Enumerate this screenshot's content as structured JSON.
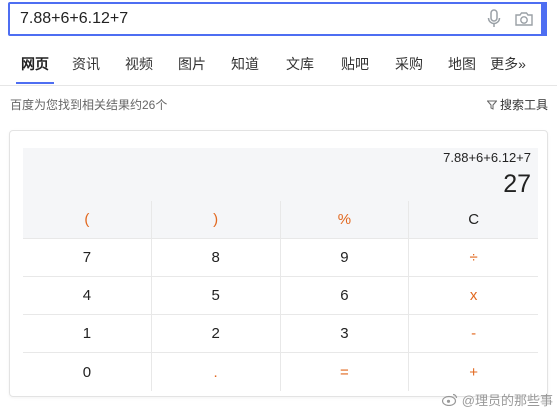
{
  "search": {
    "query": "7.88+6+6.12+7"
  },
  "tabs": [
    "网页",
    "资讯",
    "视频",
    "图片",
    "知道",
    "文库",
    "贴吧",
    "采购",
    "地图",
    "更多»"
  ],
  "result_info": "百度为您找到相关结果约26个",
  "tools_label": "搜索工具",
  "calculator": {
    "expression": "7.88+6+6.12+7",
    "result": "27",
    "keys": [
      {
        "label": "(",
        "op": true,
        "top": true
      },
      {
        "label": ")",
        "op": true,
        "top": true
      },
      {
        "label": "%",
        "op": true,
        "top": true
      },
      {
        "label": "C",
        "op": false,
        "top": true
      },
      {
        "label": "7",
        "op": false
      },
      {
        "label": "8",
        "op": false
      },
      {
        "label": "9",
        "op": false
      },
      {
        "label": "÷",
        "op": true
      },
      {
        "label": "4",
        "op": false
      },
      {
        "label": "5",
        "op": false
      },
      {
        "label": "6",
        "op": false
      },
      {
        "label": "x",
        "op": true
      },
      {
        "label": "1",
        "op": false
      },
      {
        "label": "2",
        "op": false
      },
      {
        "label": "3",
        "op": false
      },
      {
        "label": "-",
        "op": true
      },
      {
        "label": "0",
        "op": false
      },
      {
        "label": ".",
        "op": true
      },
      {
        "label": "=",
        "op": true
      },
      {
        "label": "+",
        "op": true
      }
    ]
  },
  "watermark": "@理员的那些事"
}
